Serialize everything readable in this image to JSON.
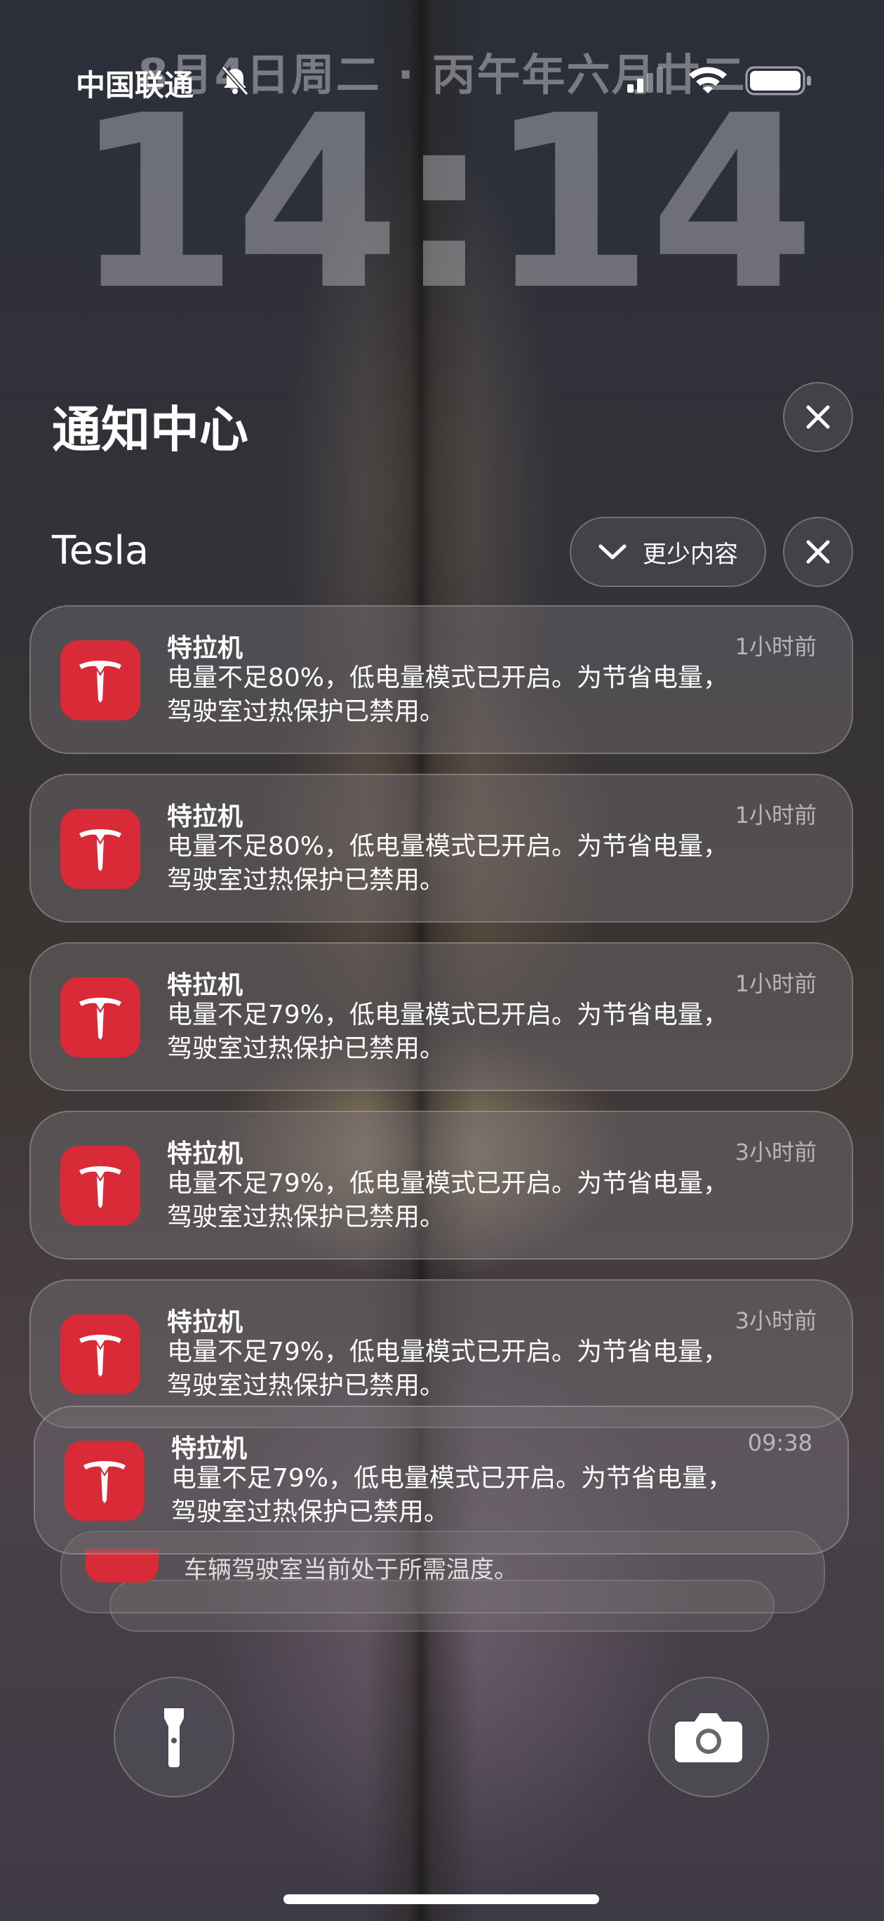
{
  "status_bar": {
    "carrier": "中国联通",
    "mute_icon": "bell-slash-icon",
    "signal_icon": "cellular-signal-icon",
    "wifi_icon": "wifi-icon",
    "battery_icon": "battery-icon"
  },
  "lock_screen": {
    "date": "8月4日周二 · 丙午年六月廿二",
    "time": "14:14"
  },
  "notification_center": {
    "title": "通知中心",
    "close_icon": "close-icon"
  },
  "group": {
    "app_name": "Tesla",
    "show_less_label": "更少内容",
    "show_less_icon": "chevron-down-icon",
    "close_icon": "close-icon"
  },
  "notifications": [
    {
      "title": "特拉机",
      "time": "1小时前",
      "body_line1": "电量不足80%，低电量模式已开启。为节省电量，",
      "body_line2": "驾驶室过热保护已禁用。",
      "icon": "tesla-logo-icon"
    },
    {
      "title": "特拉机",
      "time": "1小时前",
      "body_line1": "电量不足80%，低电量模式已开启。为节省电量，",
      "body_line2": "驾驶室过热保护已禁用。",
      "icon": "tesla-logo-icon"
    },
    {
      "title": "特拉机",
      "time": "1小时前",
      "body_line1": "电量不足79%，低电量模式已开启。为节省电量，",
      "body_line2": "驾驶室过热保护已禁用。",
      "icon": "tesla-logo-icon"
    },
    {
      "title": "特拉机",
      "time": "3小时前",
      "body_line1": "电量不足79%，低电量模式已开启。为节省电量，",
      "body_line2": "驾驶室过热保护已禁用。",
      "icon": "tesla-logo-icon"
    },
    {
      "title": "特拉机",
      "time": "3小时前",
      "body_line1": "电量不足79%，低电量模式已开启。为节省电量，",
      "body_line2": "驾驶室过热保护已禁用。",
      "icon": "tesla-logo-icon"
    },
    {
      "title": "特拉机",
      "time": "09:38",
      "body_line1": "电量不足79%，低电量模式已开启。为节省电量，",
      "body_line2": "驾驶室过热保护已禁用。",
      "icon": "tesla-logo-icon"
    }
  ],
  "stacked_notification": {
    "body": "车辆驾驶室当前处于所需温度。"
  },
  "quick_actions": {
    "flashlight_icon": "flashlight-icon",
    "camera_icon": "camera-icon"
  },
  "colors": {
    "tesla_red": "#d92b37",
    "text_primary": "#ffffff"
  }
}
